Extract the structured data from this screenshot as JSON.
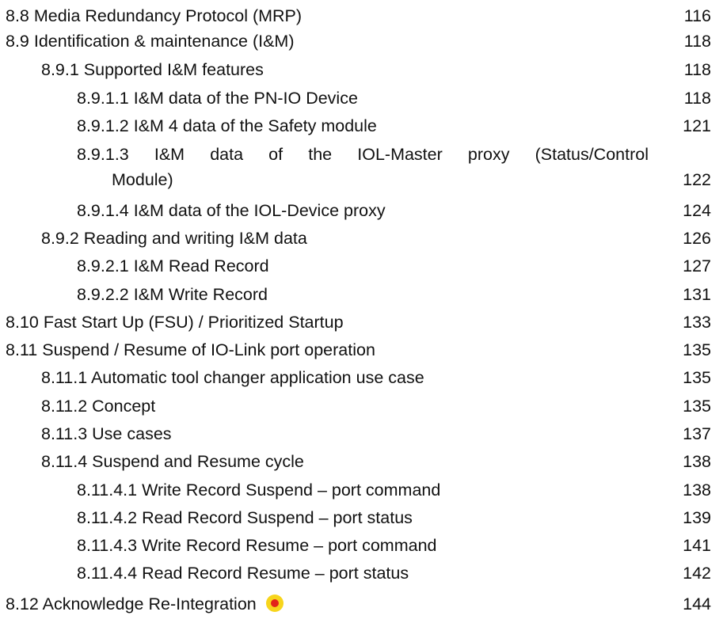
{
  "toc": {
    "entries": [
      {
        "title": "8.8 Media Redundancy Protocol (MRP)",
        "page": "116"
      },
      {
        "title": "8.9 Identification & maintenance (I&M)",
        "page": "118"
      },
      {
        "title": "8.9.1 Supported I&M features",
        "page": "118"
      },
      {
        "title": "8.9.1.1 I&M data of the PN-IO Device",
        "page": "118"
      },
      {
        "title": "8.9.1.2 I&M 4 data of the Safety module",
        "page": "121"
      },
      {
        "title_line1": "8.9.1.3 I&M data of the IOL-Master proxy (Status/Control",
        "title_line2": "Module)",
        "page": "122"
      },
      {
        "title": "8.9.1.4 I&M data of the IOL-Device proxy",
        "page": "124"
      },
      {
        "title": "8.9.2 Reading and writing I&M data",
        "page": "126"
      },
      {
        "title": "8.9.2.1 I&M Read Record",
        "page": "127"
      },
      {
        "title": "8.9.2.2 I&M Write Record",
        "page": "131"
      },
      {
        "title": "8.10 Fast Start Up (FSU) / Prioritized Startup",
        "page": "133"
      },
      {
        "title": "8.11 Suspend / Resume of IO-Link port operation",
        "page": "135"
      },
      {
        "title": "8.11.1 Automatic tool changer application use case",
        "page": "135"
      },
      {
        "title": "8.11.2 Concept",
        "page": "135"
      },
      {
        "title": "8.11.3 Use cases",
        "page": "137"
      },
      {
        "title": "8.11.4 Suspend and Resume cycle",
        "page": "138"
      },
      {
        "title": "8.11.4.1 Write Record Suspend – port command",
        "page": "138"
      },
      {
        "title": "8.11.4.2 Read Record Suspend – port status",
        "page": "139"
      },
      {
        "title": "8.11.4.3 Write Record Resume – port command",
        "page": "141"
      },
      {
        "title": "8.11.4.4 Read Record Resume – port status",
        "page": "142"
      },
      {
        "title": "8.12 Acknowledge Re-Integration",
        "page": "144",
        "marker_icon": "yellow-red-dot-icon"
      }
    ]
  },
  "colors": {
    "text": "#111111",
    "marker_outer": "#f7d51c",
    "marker_inner": "#e2231a"
  }
}
